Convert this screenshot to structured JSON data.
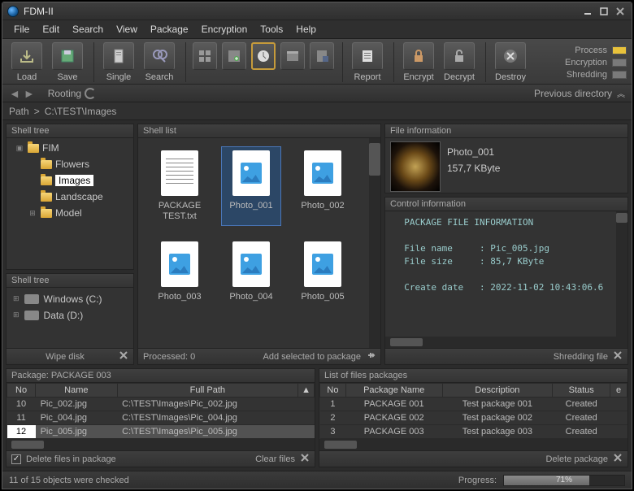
{
  "app": {
    "title": "FDM-II"
  },
  "menu": [
    "File",
    "Edit",
    "Search",
    "View",
    "Package",
    "Encryption",
    "Tools",
    "Help"
  ],
  "toolbar": {
    "groups": [
      {
        "items": [
          {
            "name": "load",
            "label": "Load"
          },
          {
            "name": "save",
            "label": "Save"
          }
        ]
      },
      {
        "items": [
          {
            "name": "single",
            "label": "Single"
          },
          {
            "name": "search",
            "label": "Search"
          }
        ]
      },
      {
        "items": [
          {
            "name": "icon-a",
            "label": ""
          },
          {
            "name": "icon-b",
            "label": ""
          },
          {
            "name": "icon-c",
            "label": ""
          },
          {
            "name": "icon-d",
            "label": ""
          },
          {
            "name": "icon-e",
            "label": ""
          }
        ]
      },
      {
        "items": [
          {
            "name": "report",
            "label": "Report"
          }
        ]
      },
      {
        "items": [
          {
            "name": "encrypt",
            "label": "Encrypt"
          },
          {
            "name": "decrypt",
            "label": "Decrypt"
          }
        ]
      },
      {
        "items": [
          {
            "name": "destroy",
            "label": "Destroy"
          }
        ]
      }
    ],
    "selected": "icon-c"
  },
  "legend": [
    {
      "label": "Process",
      "color": "#e8c23b"
    },
    {
      "label": "Encryption",
      "color": "#7a7a7a"
    },
    {
      "label": "Shredding",
      "color": "#7a7a7a"
    }
  ],
  "nav": {
    "rooting": "Rooting",
    "prev": "Previous directory"
  },
  "path": {
    "label": "Path",
    "sep": ">",
    "value": "C:\\TEST\\Images"
  },
  "tree": {
    "title": "Shell tree",
    "items": [
      {
        "label": "FIM",
        "exp": "-",
        "depth": 0
      },
      {
        "label": "Flowers",
        "exp": "",
        "depth": 1
      },
      {
        "label": "Images",
        "exp": "",
        "depth": 1,
        "sel": true
      },
      {
        "label": "Landscape",
        "exp": "",
        "depth": 1
      },
      {
        "label": "Model",
        "exp": "+",
        "depth": 1
      }
    ]
  },
  "drives": {
    "title": "Shell tree",
    "items": [
      {
        "label": "Windows (C:)"
      },
      {
        "label": "Data (D:)"
      }
    ],
    "foot": "Wipe disk"
  },
  "shelllist": {
    "title": "Shell list",
    "items": [
      {
        "label": "PACKAGE TEST.txt",
        "type": "txt"
      },
      {
        "label": "Photo_001",
        "type": "pic",
        "sel": true
      },
      {
        "label": "Photo_002",
        "type": "pic"
      },
      {
        "label": "Photo_003",
        "type": "pic"
      },
      {
        "label": "Photo_004",
        "type": "pic"
      },
      {
        "label": "Photo_005",
        "type": "pic"
      }
    ],
    "foot_left": "Processed: 0",
    "foot_right": "Add selected to package"
  },
  "fileinfo": {
    "title": "File information",
    "name": "Photo_001",
    "size": "157,7 KByte"
  },
  "control": {
    "title": "Control information",
    "heading": "PACKAGE FILE INFORMATION",
    "rows": [
      {
        "k": "File name",
        "v": "Pic_005.jpg"
      },
      {
        "k": "File size",
        "v": "85,7 KByte"
      },
      {
        "k": "",
        "v": ""
      },
      {
        "k": "Create date",
        "v": "2022-11-02 10:43:06.6"
      }
    ],
    "foot": "Shredding file"
  },
  "package": {
    "title": "Package: PACKAGE 003",
    "cols": [
      "No",
      "Name",
      "Full Path"
    ],
    "rows": [
      {
        "no": "10",
        "name": "Pic_002.jpg",
        "path": "C:\\TEST\\Images\\Pic_002.jpg"
      },
      {
        "no": "11",
        "name": "Pic_004.jpg",
        "path": "C:\\TEST\\Images\\Pic_004.jpg"
      },
      {
        "no": "12",
        "name": "Pic_005.jpg",
        "path": "C:\\TEST\\Images\\Pic_005.jpg",
        "sel": true
      }
    ],
    "foot_l_checked": true,
    "foot_l": "Delete files in package",
    "foot_r": "Clear files"
  },
  "pkglist": {
    "title": "List of files packages",
    "cols": [
      "No",
      "Package Name",
      "Description",
      "Status",
      "e"
    ],
    "rows": [
      {
        "no": "1",
        "name": "PACKAGE 001",
        "desc": "Test package 001",
        "status": "Created"
      },
      {
        "no": "2",
        "name": "PACKAGE 002",
        "desc": "Test package 002",
        "status": "Created"
      },
      {
        "no": "3",
        "name": "PACKAGE 003",
        "desc": "Test package 003",
        "status": "Created"
      }
    ],
    "foot": "Delete package"
  },
  "status": {
    "left": "11 of 15 objects were checked",
    "prog_label": "Progress:",
    "prog_pct": 71,
    "prog_text": "71%"
  }
}
